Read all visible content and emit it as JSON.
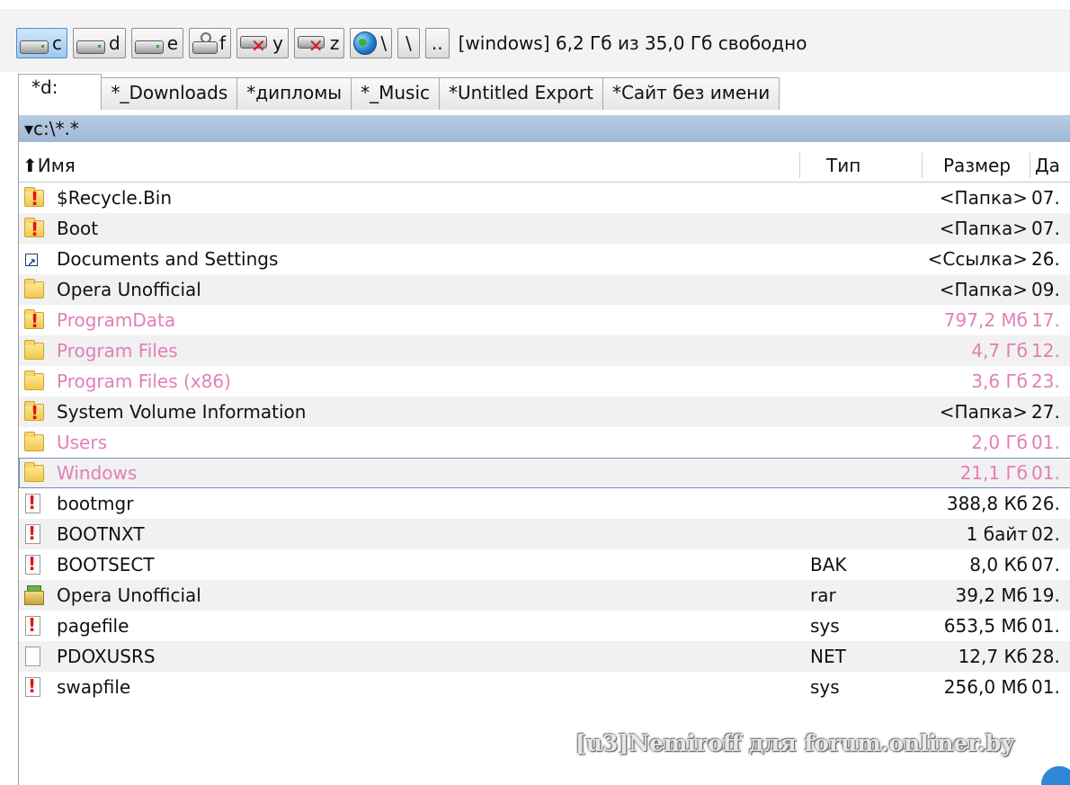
{
  "drives": [
    {
      "letter": "c",
      "icon": "hdd-icon",
      "active": true
    },
    {
      "letter": "d",
      "icon": "hdd-icon",
      "active": false
    },
    {
      "letter": "e",
      "icon": "hdd-icon",
      "active": false
    },
    {
      "letter": "f",
      "icon": "usb-drive-icon",
      "active": false
    },
    {
      "letter": "y",
      "icon": "network-drive-disconnected-icon",
      "active": false
    },
    {
      "letter": "z",
      "icon": "network-drive-disconnected-icon",
      "active": false
    }
  ],
  "nav_buttons": {
    "network_label": "\\",
    "root_label": "\\",
    "up_label": ".."
  },
  "drive_info": "[windows]  6,2 Гб из 35,0 Гб свободно",
  "tabs": [
    {
      "label": "*d:",
      "active": true
    },
    {
      "label": "*_Downloads",
      "active": false
    },
    {
      "label": "*дипломы",
      "active": false
    },
    {
      "label": "*_Music",
      "active": false
    },
    {
      "label": "*Untitled Export",
      "active": false
    },
    {
      "label": "*Сайт без имени",
      "active": false
    }
  ],
  "path": "▾c:\\*.*",
  "columns": {
    "name": "⬆Имя",
    "type": "Тип",
    "size": "Размер",
    "date": "Да"
  },
  "files": [
    {
      "name": "$Recycle.Bin",
      "type": "",
      "size": "<Папка>",
      "date": "07.",
      "icon": "system-folder",
      "pink": false
    },
    {
      "name": "Boot",
      "type": "",
      "size": "<Папка>",
      "date": "07.",
      "icon": "system-folder",
      "pink": false
    },
    {
      "name": "Documents and Settings",
      "type": "",
      "size": "<Ссылка>",
      "date": "26.",
      "icon": "link",
      "pink": false
    },
    {
      "name": "Opera Unofficial",
      "type": "",
      "size": "<Папка>",
      "date": "09.",
      "icon": "folder",
      "pink": false
    },
    {
      "name": "ProgramData",
      "type": "",
      "size": "797,2 Мб",
      "date": "17.",
      "icon": "system-folder",
      "pink": true
    },
    {
      "name": "Program Files",
      "type": "",
      "size": "4,7 Гб",
      "date": "12.",
      "icon": "folder",
      "pink": true
    },
    {
      "name": "Program Files (x86)",
      "type": "",
      "size": "3,6 Гб",
      "date": "23.",
      "icon": "folder",
      "pink": true
    },
    {
      "name": "System Volume Information",
      "type": "",
      "size": "<Папка>",
      "date": "27.",
      "icon": "system-folder",
      "pink": false
    },
    {
      "name": "Users",
      "type": "",
      "size": "2,0 Гб",
      "date": "01.",
      "icon": "folder",
      "pink": true
    },
    {
      "name": "Windows",
      "type": "",
      "size": "21,1 Гб",
      "date": "01.",
      "icon": "folder",
      "pink": true,
      "focused": true
    },
    {
      "name": "bootmgr",
      "type": "",
      "size": "388,8 Кб",
      "date": "26.",
      "icon": "system-file",
      "pink": false
    },
    {
      "name": "BOOTNXT",
      "type": "",
      "size": "1 байт",
      "date": "02.",
      "icon": "system-file",
      "pink": false
    },
    {
      "name": "BOOTSECT",
      "type": "BAK",
      "size": "8,0 Кб",
      "date": "07.",
      "icon": "system-file",
      "pink": false
    },
    {
      "name": "Opera Unofficial",
      "type": "rar",
      "size": "39,2 Мб",
      "date": "19.",
      "icon": "archive",
      "pink": false
    },
    {
      "name": "pagefile",
      "type": "sys",
      "size": "653,5 Мб",
      "date": "01.",
      "icon": "system-file",
      "pink": false
    },
    {
      "name": "PDOXUSRS",
      "type": "NET",
      "size": "12,7 Кб",
      "date": "28.",
      "icon": "file",
      "pink": false
    },
    {
      "name": "swapfile",
      "type": "sys",
      "size": "256,0 Мб",
      "date": "01.",
      "icon": "system-file",
      "pink": false
    }
  ],
  "watermark": "[u3]Nemiroff для forum.onliner.by"
}
